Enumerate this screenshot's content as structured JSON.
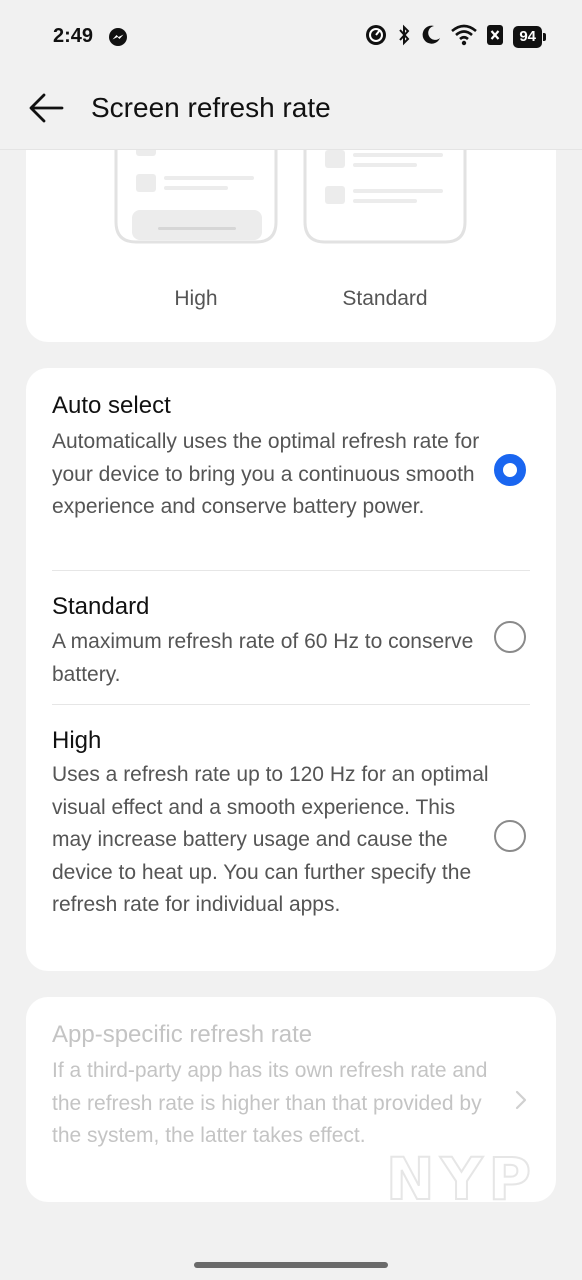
{
  "status_bar": {
    "time": "2:49",
    "battery": "94",
    "icons": [
      "messenger-icon",
      "data-saver-icon",
      "bluetooth-icon",
      "do-not-disturb-icon",
      "wifi-icon",
      "sim-icon",
      "battery-icon"
    ]
  },
  "header": {
    "title": "Screen refresh rate",
    "back_icon": "arrow-left-icon"
  },
  "preview": {
    "labels": [
      "High",
      "Standard"
    ]
  },
  "options": [
    {
      "title": "Auto select",
      "description": "Automatically uses the optimal refresh rate for your device to bring you a continuous smooth experience and conserve battery power.",
      "selected": true
    },
    {
      "title": "Standard",
      "description": "A maximum refresh rate of 60 Hz to conserve battery.",
      "selected": false
    },
    {
      "title": "High",
      "description": "Uses a refresh rate up to 120 Hz for an optimal visual effect and a smooth experience. This may increase battery usage and cause the device to heat up. You can further specify the refresh rate for individual apps.",
      "selected": false
    }
  ],
  "app_specific": {
    "title": "App-specific refresh rate",
    "description": "If a third-party app has its own refresh rate and the refresh rate is higher than that provided by the system, the latter takes effect.",
    "enabled": false
  },
  "watermark": "NYP",
  "colors": {
    "accent": "#1a66f0",
    "background": "#f1f1f1",
    "card": "#ffffff",
    "disabled_text": "#c4c4c4",
    "secondary_text": "#555555"
  }
}
